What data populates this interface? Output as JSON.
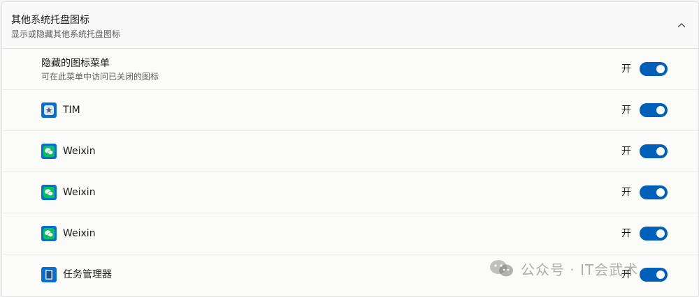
{
  "section": {
    "title": "其他系统托盘图标",
    "subtitle": "显示或隐藏其他系统托盘图标",
    "expanded": true
  },
  "hidden_menu": {
    "title": "隐藏的图标菜单",
    "subtitle": "可在此菜单中访问已关闭的图标",
    "state_label": "开",
    "on": true
  },
  "apps": [
    {
      "label": "TIM",
      "icon": "tim-icon",
      "state_label": "开",
      "on": true
    },
    {
      "label": "Weixin",
      "icon": "weixin-icon",
      "state_label": "开",
      "on": true
    },
    {
      "label": "Weixin",
      "icon": "weixin-icon",
      "state_label": "开",
      "on": true
    },
    {
      "label": "Weixin",
      "icon": "weixin-icon",
      "state_label": "开",
      "on": true
    },
    {
      "label": "任务管理器",
      "icon": "task-manager-icon",
      "state_label": "开",
      "on": true
    }
  ],
  "watermark": {
    "text": "公众号 · IT会武术"
  },
  "colors": {
    "accent": "#005fb8",
    "weixin_green": "#07c160",
    "icon_blue": "#0a6ed1"
  }
}
